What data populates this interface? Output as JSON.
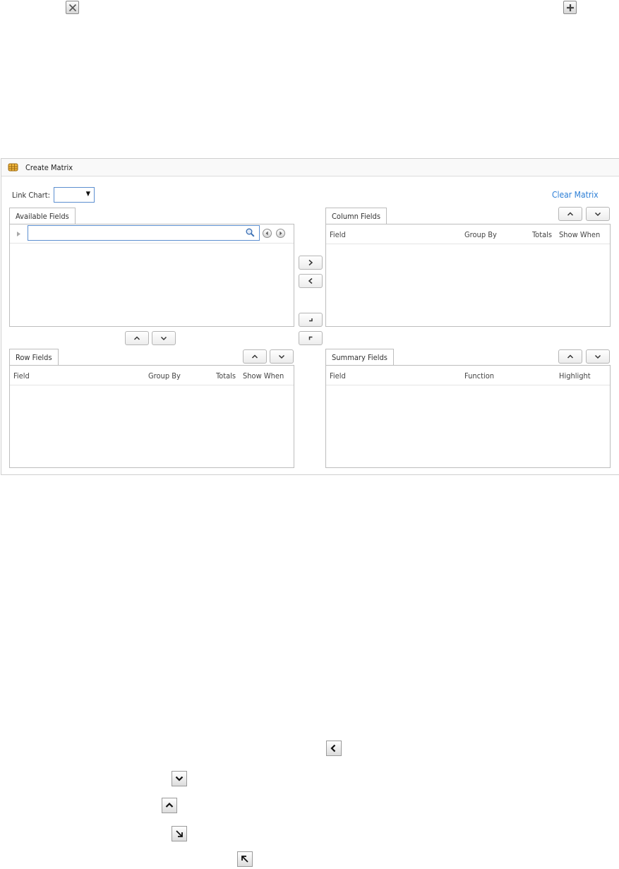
{
  "panel": {
    "title": "Create Matrix",
    "link_chart_label": "Link Chart:",
    "link_chart_value": "",
    "clear_matrix_label": "Clear Matrix"
  },
  "available_fields": {
    "tab_label": "Available Fields",
    "search_value": "",
    "icons": [
      "expand-triangle-icon",
      "search-icon",
      "previous-icon",
      "next-icon"
    ]
  },
  "column_fields": {
    "tab_label": "Column Fields",
    "columns": [
      "Field",
      "Group By",
      "Totals",
      "Show When"
    ]
  },
  "row_fields": {
    "tab_label": "Row Fields",
    "columns": [
      "Field",
      "Group By",
      "Totals",
      "Show When"
    ]
  },
  "summary_fields": {
    "tab_label": "Summary Fields",
    "columns": [
      "Field",
      "Function",
      "Highlight"
    ]
  },
  "transfer_buttons": [
    "add-to-columns",
    "remove-from-columns",
    "move-to-rows",
    "move-from-rows"
  ],
  "doc_icons": [
    "close-icon",
    "expand-plus-icon"
  ],
  "legacy_buttons": [
    "chevron-left-icon",
    "chevron-down-icon",
    "chevron-up-icon",
    "arrow-down-right-icon",
    "arrow-up-left-icon"
  ],
  "colors": {
    "accent": "#2b7ed6",
    "input_border": "#5c8fd0",
    "border": "#bdbdbd"
  }
}
